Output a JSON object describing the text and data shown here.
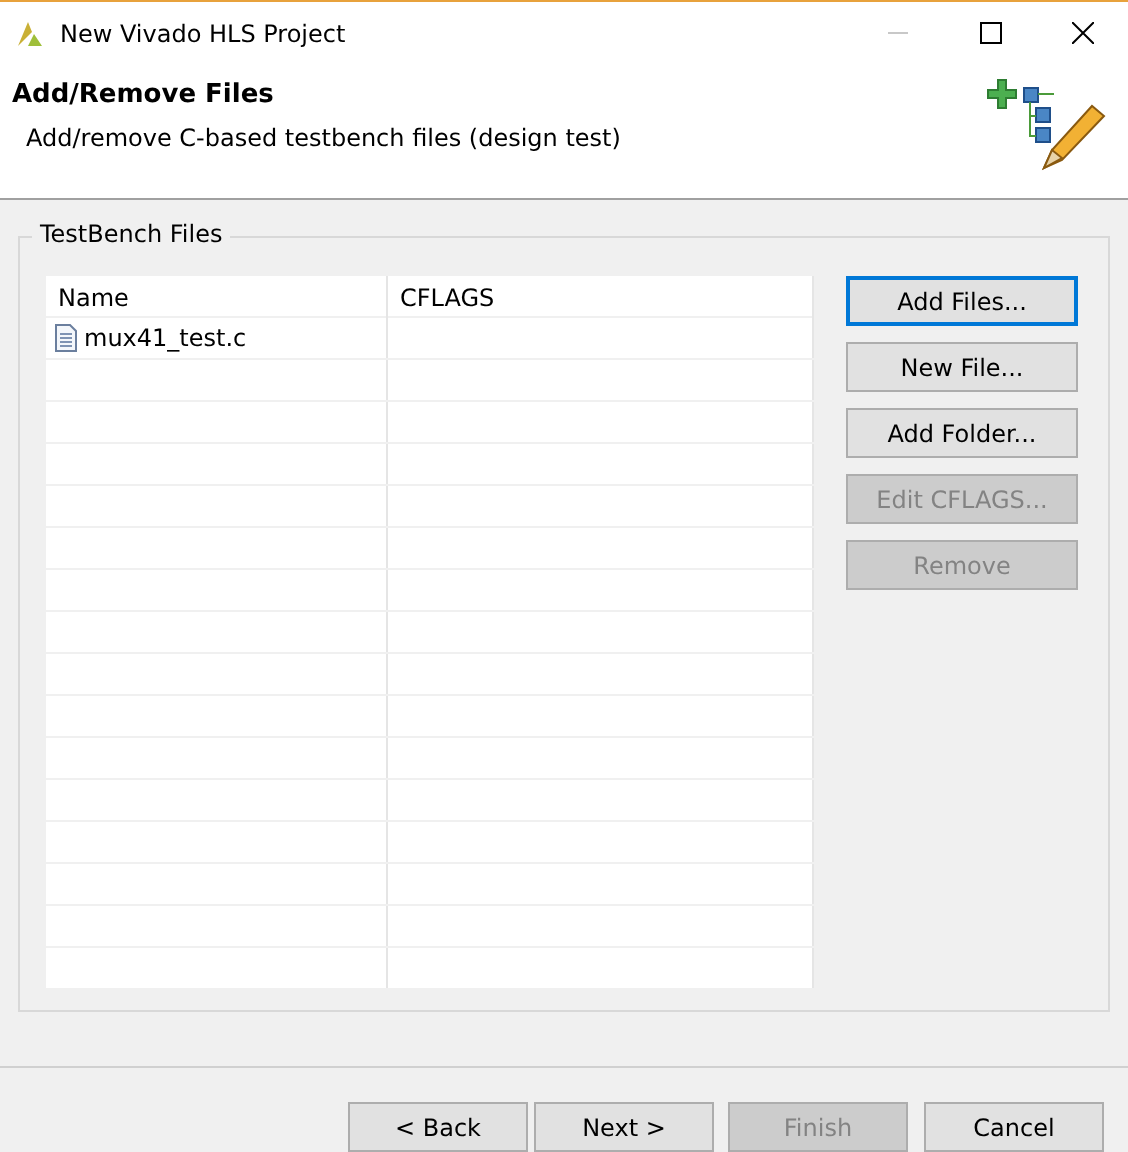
{
  "window": {
    "title": "New Vivado HLS Project"
  },
  "header": {
    "title": "Add/Remove Files",
    "subtitle": "Add/remove C-based testbench files (design test)"
  },
  "group": {
    "title": "TestBench Files"
  },
  "table": {
    "columns": [
      "Name",
      "CFLAGS"
    ],
    "rows": [
      {
        "name": "mux41_test.c",
        "cflags": ""
      }
    ]
  },
  "side_buttons": [
    {
      "label": "Add Files...",
      "disabled": false,
      "focused": true
    },
    {
      "label": "New File...",
      "disabled": false,
      "focused": false
    },
    {
      "label": "Add Folder...",
      "disabled": false,
      "focused": false
    },
    {
      "label": "Edit CFLAGS...",
      "disabled": true,
      "focused": false
    },
    {
      "label": "Remove",
      "disabled": true,
      "focused": false
    }
  ],
  "footer_buttons": [
    {
      "label": "< Back",
      "disabled": false
    },
    {
      "label": "Next >",
      "disabled": false
    },
    {
      "label": "Finish",
      "disabled": true
    },
    {
      "label": "Cancel",
      "disabled": false
    }
  ]
}
